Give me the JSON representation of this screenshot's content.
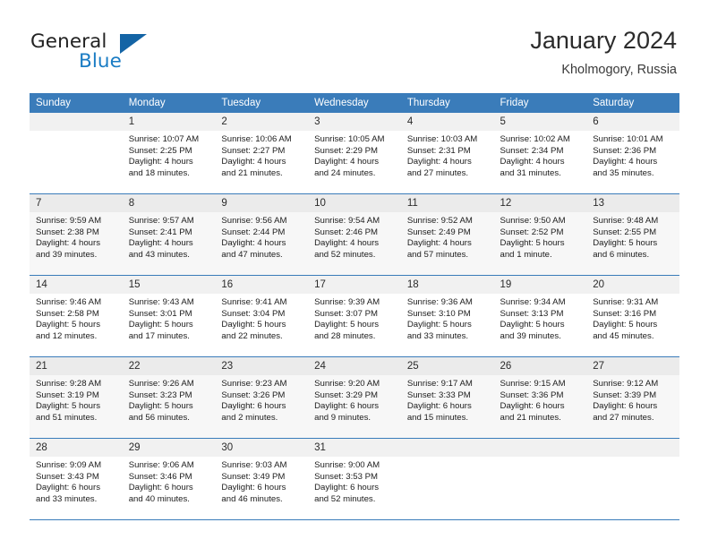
{
  "brand": {
    "name_part1": "General",
    "name_part2": "Blue",
    "triangle_color": "#1464a5",
    "blue_color": "#1a7cc4"
  },
  "header": {
    "title": "January 2024",
    "subtitle": "Kholmogory, Russia",
    "header_bg_color": "#3a7cba"
  },
  "weekday_headers": [
    "Sunday",
    "Monday",
    "Tuesday",
    "Wednesday",
    "Thursday",
    "Friday",
    "Saturday"
  ],
  "weeks": [
    {
      "days": [
        {
          "num": "",
          "sunrise": "",
          "sunset": "",
          "daylight1": "",
          "daylight2": ""
        },
        {
          "num": "1",
          "sunrise": "Sunrise: 10:07 AM",
          "sunset": "Sunset: 2:25 PM",
          "daylight1": "Daylight: 4 hours",
          "daylight2": "and 18 minutes."
        },
        {
          "num": "2",
          "sunrise": "Sunrise: 10:06 AM",
          "sunset": "Sunset: 2:27 PM",
          "daylight1": "Daylight: 4 hours",
          "daylight2": "and 21 minutes."
        },
        {
          "num": "3",
          "sunrise": "Sunrise: 10:05 AM",
          "sunset": "Sunset: 2:29 PM",
          "daylight1": "Daylight: 4 hours",
          "daylight2": "and 24 minutes."
        },
        {
          "num": "4",
          "sunrise": "Sunrise: 10:03 AM",
          "sunset": "Sunset: 2:31 PM",
          "daylight1": "Daylight: 4 hours",
          "daylight2": "and 27 minutes."
        },
        {
          "num": "5",
          "sunrise": "Sunrise: 10:02 AM",
          "sunset": "Sunset: 2:34 PM",
          "daylight1": "Daylight: 4 hours",
          "daylight2": "and 31 minutes."
        },
        {
          "num": "6",
          "sunrise": "Sunrise: 10:01 AM",
          "sunset": "Sunset: 2:36 PM",
          "daylight1": "Daylight: 4 hours",
          "daylight2": "and 35 minutes."
        }
      ]
    },
    {
      "days": [
        {
          "num": "7",
          "sunrise": "Sunrise: 9:59 AM",
          "sunset": "Sunset: 2:38 PM",
          "daylight1": "Daylight: 4 hours",
          "daylight2": "and 39 minutes."
        },
        {
          "num": "8",
          "sunrise": "Sunrise: 9:57 AM",
          "sunset": "Sunset: 2:41 PM",
          "daylight1": "Daylight: 4 hours",
          "daylight2": "and 43 minutes."
        },
        {
          "num": "9",
          "sunrise": "Sunrise: 9:56 AM",
          "sunset": "Sunset: 2:44 PM",
          "daylight1": "Daylight: 4 hours",
          "daylight2": "and 47 minutes."
        },
        {
          "num": "10",
          "sunrise": "Sunrise: 9:54 AM",
          "sunset": "Sunset: 2:46 PM",
          "daylight1": "Daylight: 4 hours",
          "daylight2": "and 52 minutes."
        },
        {
          "num": "11",
          "sunrise": "Sunrise: 9:52 AM",
          "sunset": "Sunset: 2:49 PM",
          "daylight1": "Daylight: 4 hours",
          "daylight2": "and 57 minutes."
        },
        {
          "num": "12",
          "sunrise": "Sunrise: 9:50 AM",
          "sunset": "Sunset: 2:52 PM",
          "daylight1": "Daylight: 5 hours",
          "daylight2": "and 1 minute."
        },
        {
          "num": "13",
          "sunrise": "Sunrise: 9:48 AM",
          "sunset": "Sunset: 2:55 PM",
          "daylight1": "Daylight: 5 hours",
          "daylight2": "and 6 minutes."
        }
      ]
    },
    {
      "days": [
        {
          "num": "14",
          "sunrise": "Sunrise: 9:46 AM",
          "sunset": "Sunset: 2:58 PM",
          "daylight1": "Daylight: 5 hours",
          "daylight2": "and 12 minutes."
        },
        {
          "num": "15",
          "sunrise": "Sunrise: 9:43 AM",
          "sunset": "Sunset: 3:01 PM",
          "daylight1": "Daylight: 5 hours",
          "daylight2": "and 17 minutes."
        },
        {
          "num": "16",
          "sunrise": "Sunrise: 9:41 AM",
          "sunset": "Sunset: 3:04 PM",
          "daylight1": "Daylight: 5 hours",
          "daylight2": "and 22 minutes."
        },
        {
          "num": "17",
          "sunrise": "Sunrise: 9:39 AM",
          "sunset": "Sunset: 3:07 PM",
          "daylight1": "Daylight: 5 hours",
          "daylight2": "and 28 minutes."
        },
        {
          "num": "18",
          "sunrise": "Sunrise: 9:36 AM",
          "sunset": "Sunset: 3:10 PM",
          "daylight1": "Daylight: 5 hours",
          "daylight2": "and 33 minutes."
        },
        {
          "num": "19",
          "sunrise": "Sunrise: 9:34 AM",
          "sunset": "Sunset: 3:13 PM",
          "daylight1": "Daylight: 5 hours",
          "daylight2": "and 39 minutes."
        },
        {
          "num": "20",
          "sunrise": "Sunrise: 9:31 AM",
          "sunset": "Sunset: 3:16 PM",
          "daylight1": "Daylight: 5 hours",
          "daylight2": "and 45 minutes."
        }
      ]
    },
    {
      "days": [
        {
          "num": "21",
          "sunrise": "Sunrise: 9:28 AM",
          "sunset": "Sunset: 3:19 PM",
          "daylight1": "Daylight: 5 hours",
          "daylight2": "and 51 minutes."
        },
        {
          "num": "22",
          "sunrise": "Sunrise: 9:26 AM",
          "sunset": "Sunset: 3:23 PM",
          "daylight1": "Daylight: 5 hours",
          "daylight2": "and 56 minutes."
        },
        {
          "num": "23",
          "sunrise": "Sunrise: 9:23 AM",
          "sunset": "Sunset: 3:26 PM",
          "daylight1": "Daylight: 6 hours",
          "daylight2": "and 2 minutes."
        },
        {
          "num": "24",
          "sunrise": "Sunrise: 9:20 AM",
          "sunset": "Sunset: 3:29 PM",
          "daylight1": "Daylight: 6 hours",
          "daylight2": "and 9 minutes."
        },
        {
          "num": "25",
          "sunrise": "Sunrise: 9:17 AM",
          "sunset": "Sunset: 3:33 PM",
          "daylight1": "Daylight: 6 hours",
          "daylight2": "and 15 minutes."
        },
        {
          "num": "26",
          "sunrise": "Sunrise: 9:15 AM",
          "sunset": "Sunset: 3:36 PM",
          "daylight1": "Daylight: 6 hours",
          "daylight2": "and 21 minutes."
        },
        {
          "num": "27",
          "sunrise": "Sunrise: 9:12 AM",
          "sunset": "Sunset: 3:39 PM",
          "daylight1": "Daylight: 6 hours",
          "daylight2": "and 27 minutes."
        }
      ]
    },
    {
      "days": [
        {
          "num": "28",
          "sunrise": "Sunrise: 9:09 AM",
          "sunset": "Sunset: 3:43 PM",
          "daylight1": "Daylight: 6 hours",
          "daylight2": "and 33 minutes."
        },
        {
          "num": "29",
          "sunrise": "Sunrise: 9:06 AM",
          "sunset": "Sunset: 3:46 PM",
          "daylight1": "Daylight: 6 hours",
          "daylight2": "and 40 minutes."
        },
        {
          "num": "30",
          "sunrise": "Sunrise: 9:03 AM",
          "sunset": "Sunset: 3:49 PM",
          "daylight1": "Daylight: 6 hours",
          "daylight2": "and 46 minutes."
        },
        {
          "num": "31",
          "sunrise": "Sunrise: 9:00 AM",
          "sunset": "Sunset: 3:53 PM",
          "daylight1": "Daylight: 6 hours",
          "daylight2": "and 52 minutes."
        },
        {
          "num": "",
          "sunrise": "",
          "sunset": "",
          "daylight1": "",
          "daylight2": ""
        },
        {
          "num": "",
          "sunrise": "",
          "sunset": "",
          "daylight1": "",
          "daylight2": ""
        },
        {
          "num": "",
          "sunrise": "",
          "sunset": "",
          "daylight1": "",
          "daylight2": ""
        }
      ]
    }
  ]
}
